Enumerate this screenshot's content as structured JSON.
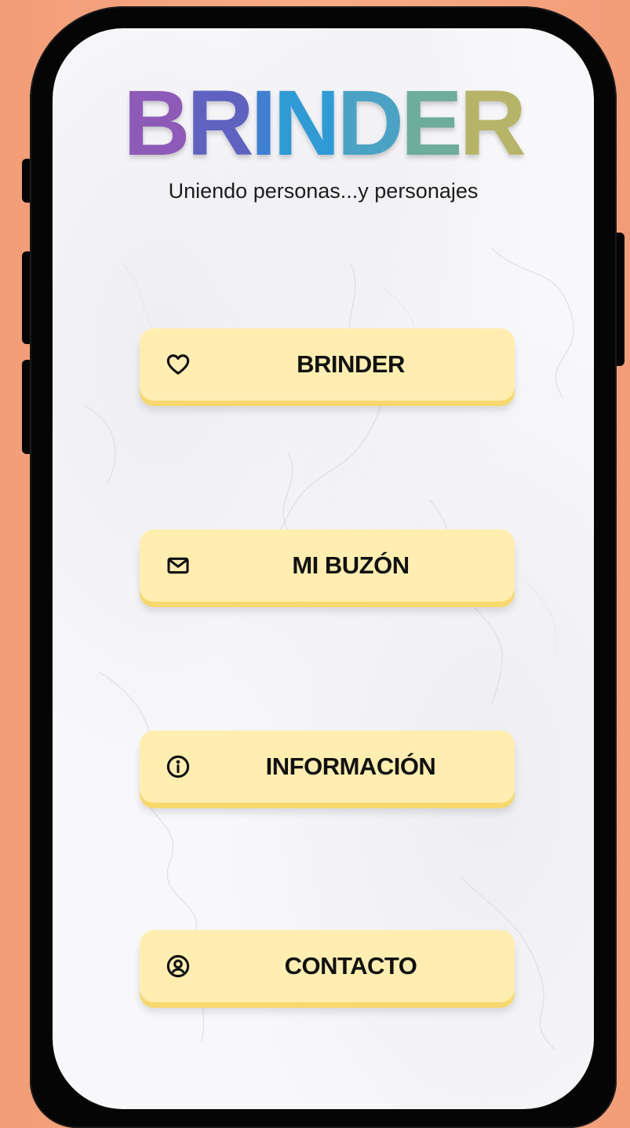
{
  "app": {
    "logo_letters": [
      "B",
      "R",
      "I",
      "N",
      "D",
      "E",
      "R"
    ],
    "logo_colors": [
      "#8e5ab8",
      "#5f62c0",
      "#3e7fd1",
      "#2f9bd6",
      "#4aa3c4",
      "#6eac9c",
      "#b6b468"
    ],
    "tagline": "Uniendo personas...y personajes"
  },
  "menu": [
    {
      "label": "BRINDER",
      "icon": "heart-icon"
    },
    {
      "label": "MI BUZÓN",
      "icon": "envelope-icon"
    },
    {
      "label": "INFORMACIÓN",
      "icon": "info-icon"
    },
    {
      "label": "CONTACTO",
      "icon": "user-circle-icon"
    }
  ],
  "colors": {
    "background": "#f6a47f",
    "button_fill": "#ffeeb0",
    "button_edge": "#f7d86e"
  }
}
